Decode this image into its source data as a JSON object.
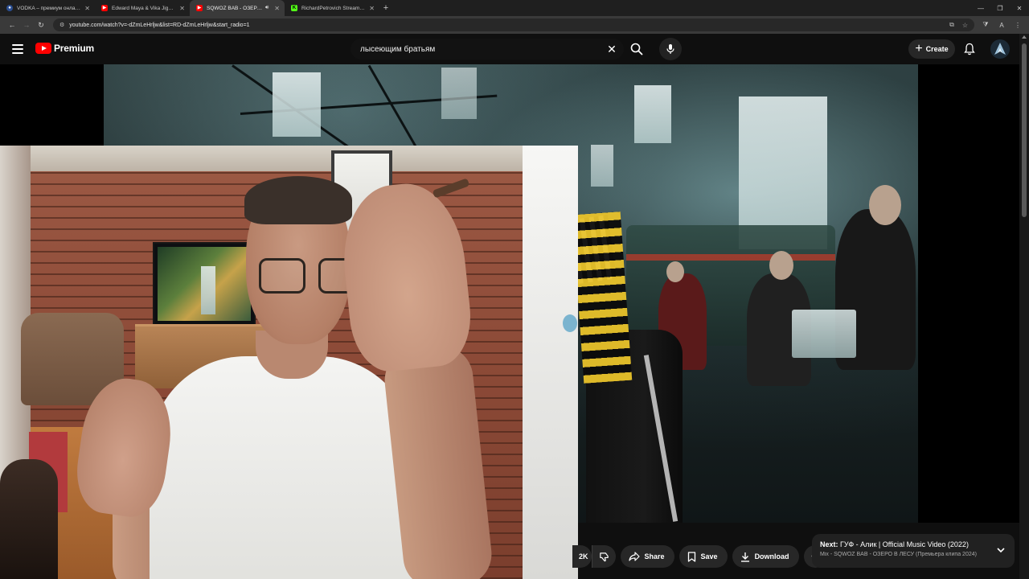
{
  "browser": {
    "tabs": [
      {
        "title": "VODKA – премиум онлайн-каз...",
        "favicon": "vodka-icon",
        "active": false
      },
      {
        "title": "Edward Maya & Vika Jigulina - ...",
        "favicon": "youtube-icon",
        "active": false
      },
      {
        "title": "SQWOZ BAB - ОЗЕРО В ЛЕ...",
        "favicon": "youtube-icon",
        "active": true,
        "audio": true
      },
      {
        "title": "RichardPetrovich Stream - Watc...",
        "favicon": "kick-icon",
        "active": false
      }
    ],
    "new_tab": "+",
    "url": "youtube.com/watch?v=-dZmLeHrljw&list=RD-dZmLeHrljw&start_radio=1"
  },
  "youtube": {
    "logo_text": "Premium",
    "search_query": "лысеющим братьям",
    "create_label": "Create"
  },
  "actions": {
    "likes_suffix": "2K",
    "share_label": "Share",
    "save_label": "Save",
    "download_label": "Download"
  },
  "up_next": {
    "prefix": "Next:",
    "title": "ГУФ - Алик | Official Music Video (2022)",
    "subtitle": "Mix - SQWOZ BAB - ОЗЕРО В ЛЕСУ (Премьера клипа 2024)"
  },
  "colors": {
    "brand_red": "#ff0000",
    "background": "#0f0f0f",
    "chip": "#272727",
    "kick_green": "#53fc18"
  }
}
